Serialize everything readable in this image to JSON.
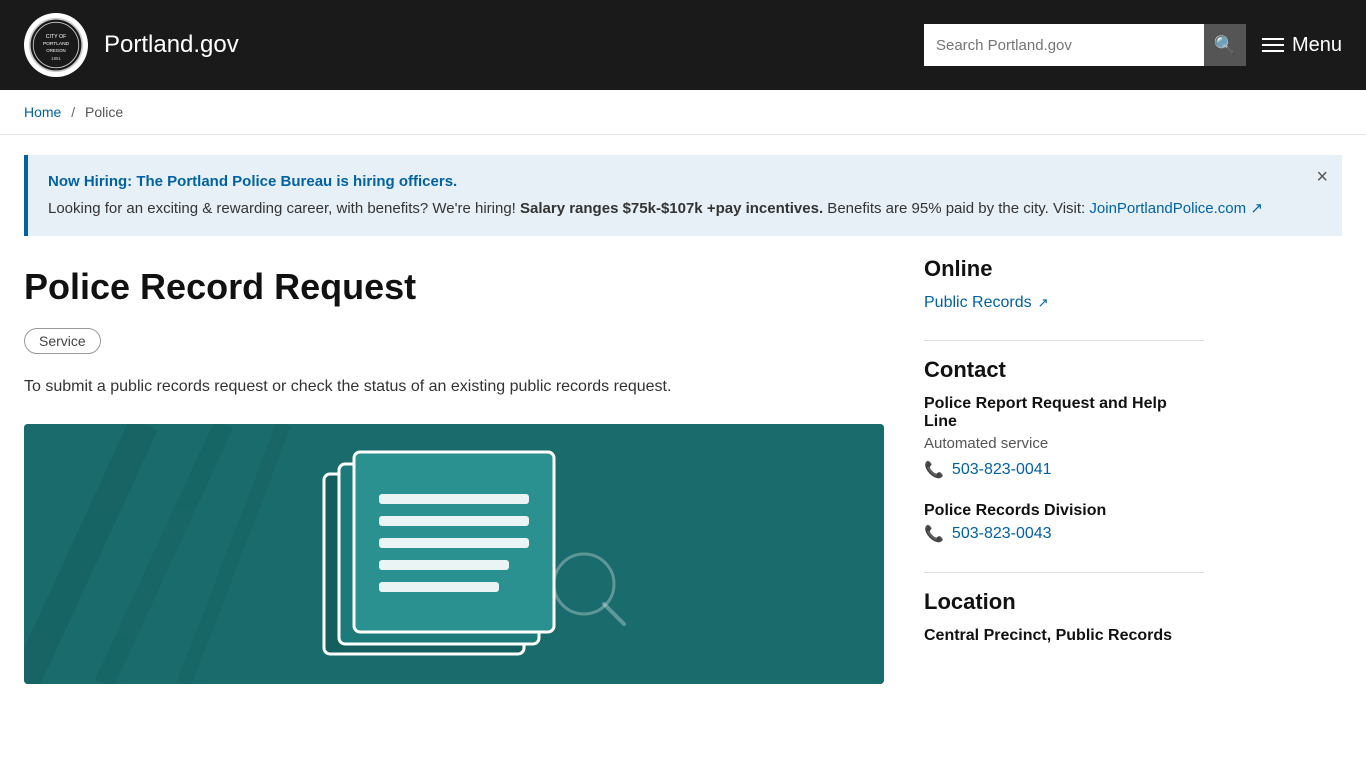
{
  "header": {
    "logo_alt": "City of Portland seal",
    "title": "Portland.gov",
    "search_placeholder": "Search Portland.gov",
    "menu_label": "Menu"
  },
  "breadcrumb": {
    "home": "Home",
    "current": "Police"
  },
  "alert": {
    "title": "Now Hiring: The Portland Police Bureau is hiring officers.",
    "body_before": "Looking for an exciting & rewarding career, with benefits? We're hiring! ",
    "body_bold": "Salary ranges $75k-$107k +pay incentives.",
    "body_after": " Benefits are 95% paid by the city. Visit: ",
    "link_text": "JoinPortlandPolice.com",
    "link_href": "#",
    "close_label": "×"
  },
  "page": {
    "title": "Police Record Request",
    "badge": "Service",
    "description": "To submit a public records request or check the status of an existing public records request."
  },
  "sidebar": {
    "online_heading": "Online",
    "public_records_label": "Public Records",
    "public_records_href": "#",
    "contact_heading": "Contact",
    "contact1_name": "Police Report Request and Help Line",
    "contact1_sub": "Automated service",
    "contact1_phone": "503-823-0041",
    "contact1_phone_href": "tel:5038230041",
    "contact2_name": "Police Records Division",
    "contact2_phone": "503-823-0043",
    "contact2_phone_href": "tel:5038230043",
    "location_heading": "Location",
    "location_name": "Central Precinct, Public Records"
  }
}
